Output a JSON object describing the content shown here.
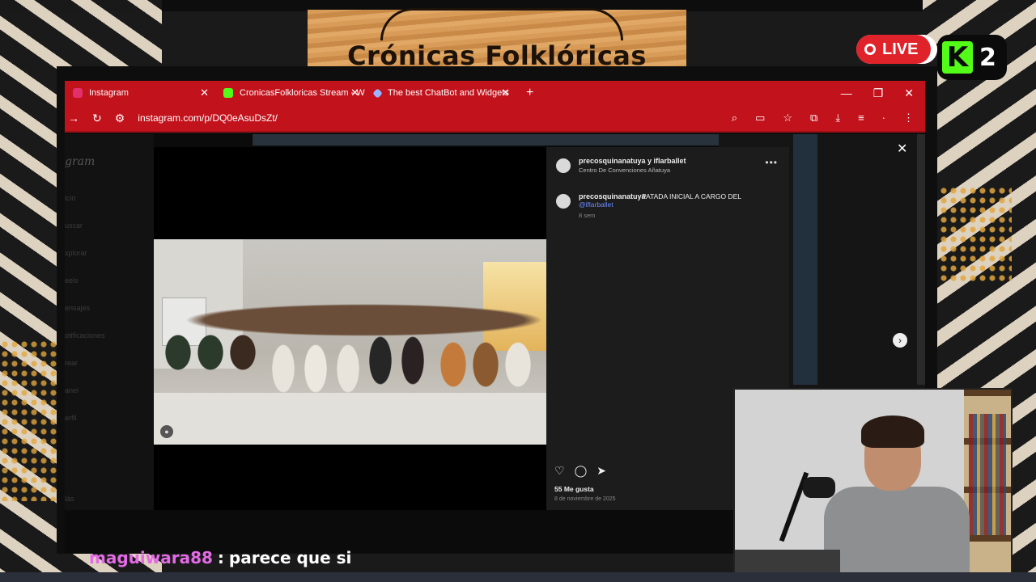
{
  "overlay": {
    "banner_title": "Crónicas Folklóricas",
    "live_label": "LIVE",
    "kick_icon": "K",
    "viewer_count": "2"
  },
  "browser": {
    "tabs": [
      {
        "label": "Instagram",
        "icon": "instagram-icon",
        "color": "#e1306c"
      },
      {
        "label": "CronicasFolkloricas Stream - W",
        "icon": "kick-icon",
        "color": "#53fc18"
      },
      {
        "label": "The best ChatBot and Widgets",
        "icon": "diamond-icon",
        "color": "#9ab4ff"
      }
    ],
    "new_tab": "+",
    "url": "instagram.com/p/DQ0eAsuDsZt/"
  },
  "instagram": {
    "logo": "gram",
    "nav": [
      "icio",
      "uscar",
      "xplorar",
      "eels",
      "ensajes",
      "otificaciones",
      "rear",
      "anel",
      "erfil",
      "lás"
    ],
    "post": {
      "header_user": "precosquinanatuya y iflarballet",
      "location": "Centro De Convenciones Añatuya",
      "caption_user": "precosquinanatuya",
      "caption_text": "PATADA INICIAL A CARGO DEL",
      "caption_mention": "@iflarballet",
      "caption_time": "8 sem",
      "likes": "55 Me gusta",
      "date": "8 de noviembre de 2025"
    }
  },
  "chat": {
    "username": "maguiwara88",
    "separator": ":",
    "message": "parece que si"
  },
  "colors": {
    "browser_red": "#c2121c",
    "live_red": "#e0222a",
    "kick_green": "#53fc18",
    "chat_user": "#e46ae6"
  }
}
